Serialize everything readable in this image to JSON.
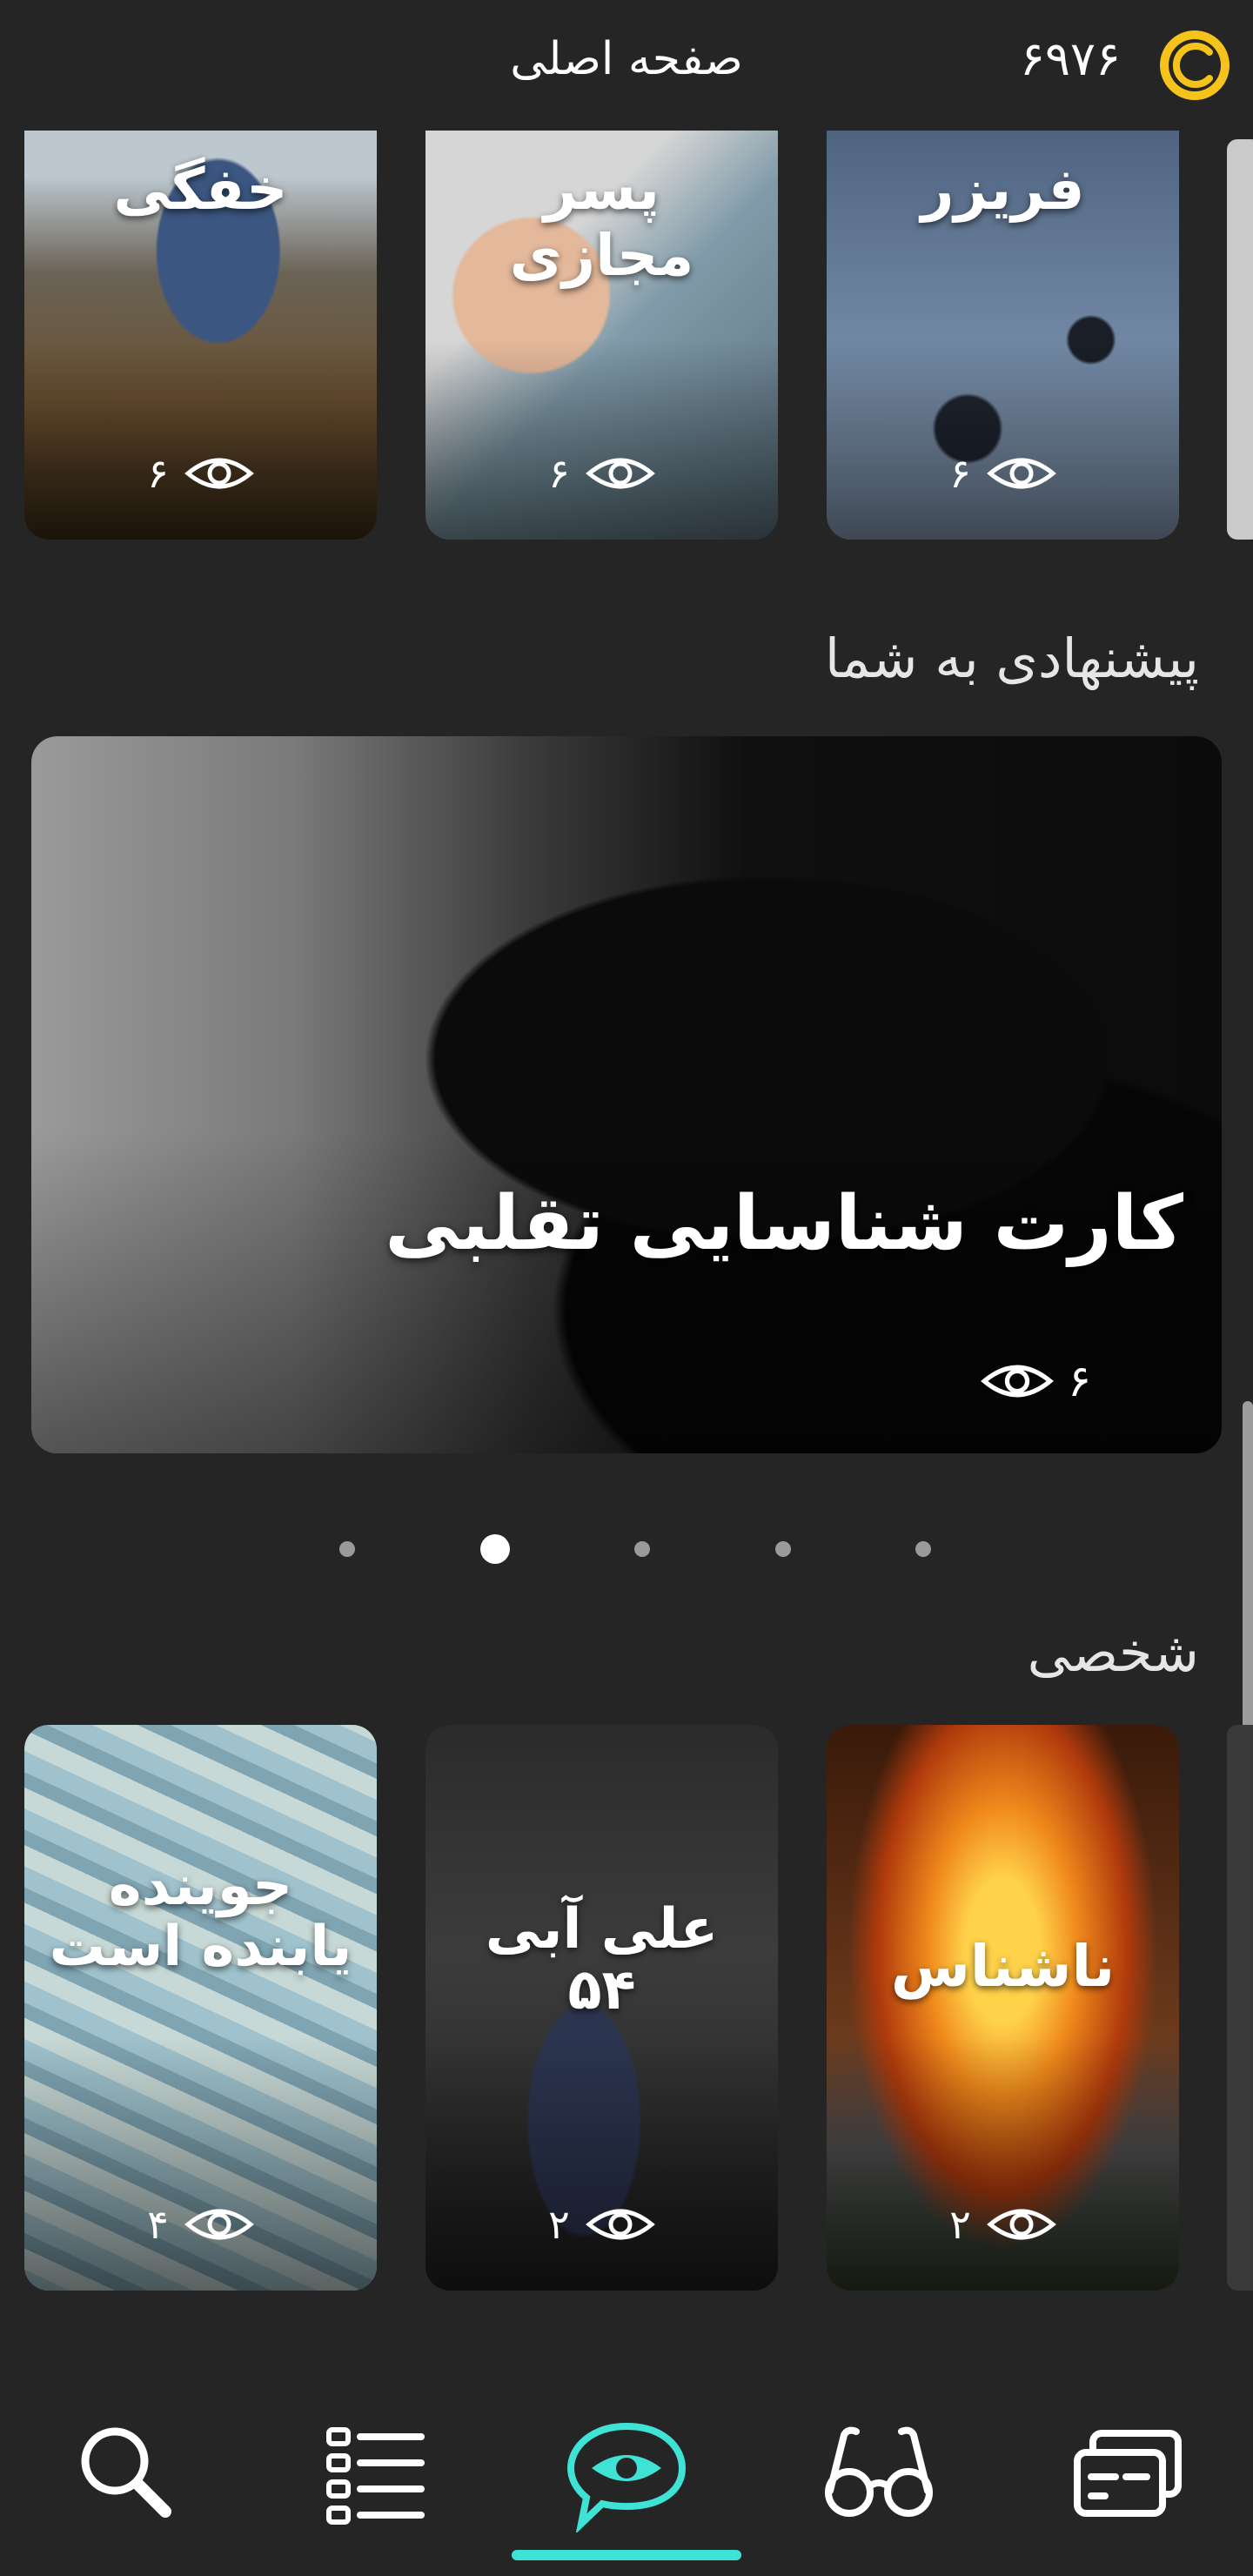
{
  "header": {
    "coin_count": "۶۹۷۶",
    "title": "صفحه اصلی",
    "accent_color": "#f6c31a"
  },
  "top_row": [
    {
      "title": "خفگی",
      "views": "۶"
    },
    {
      "title": "پسر مجازی",
      "views": "۶"
    },
    {
      "title": "فریزر",
      "views": "۶"
    }
  ],
  "suggested": {
    "section_title": "پیشنهادی به شما",
    "featured": {
      "title": "کارت شناسایی تقلبی",
      "views": "۶"
    },
    "pager": {
      "count": 5,
      "active_index": 1
    }
  },
  "personal": {
    "section_title": "شخصی",
    "cards": [
      {
        "title": "جوینده یابنده است",
        "views": "۴"
      },
      {
        "title": "علی آبی ۵۴",
        "views": "۲"
      },
      {
        "title": "ناشناس",
        "views": "۲"
      }
    ]
  },
  "bottom_nav": {
    "items": [
      "search-icon",
      "list-icon",
      "eye-chat-icon",
      "glasses-icon",
      "card-icon"
    ],
    "active_index": 2,
    "active_color": "#3fe3d6"
  }
}
